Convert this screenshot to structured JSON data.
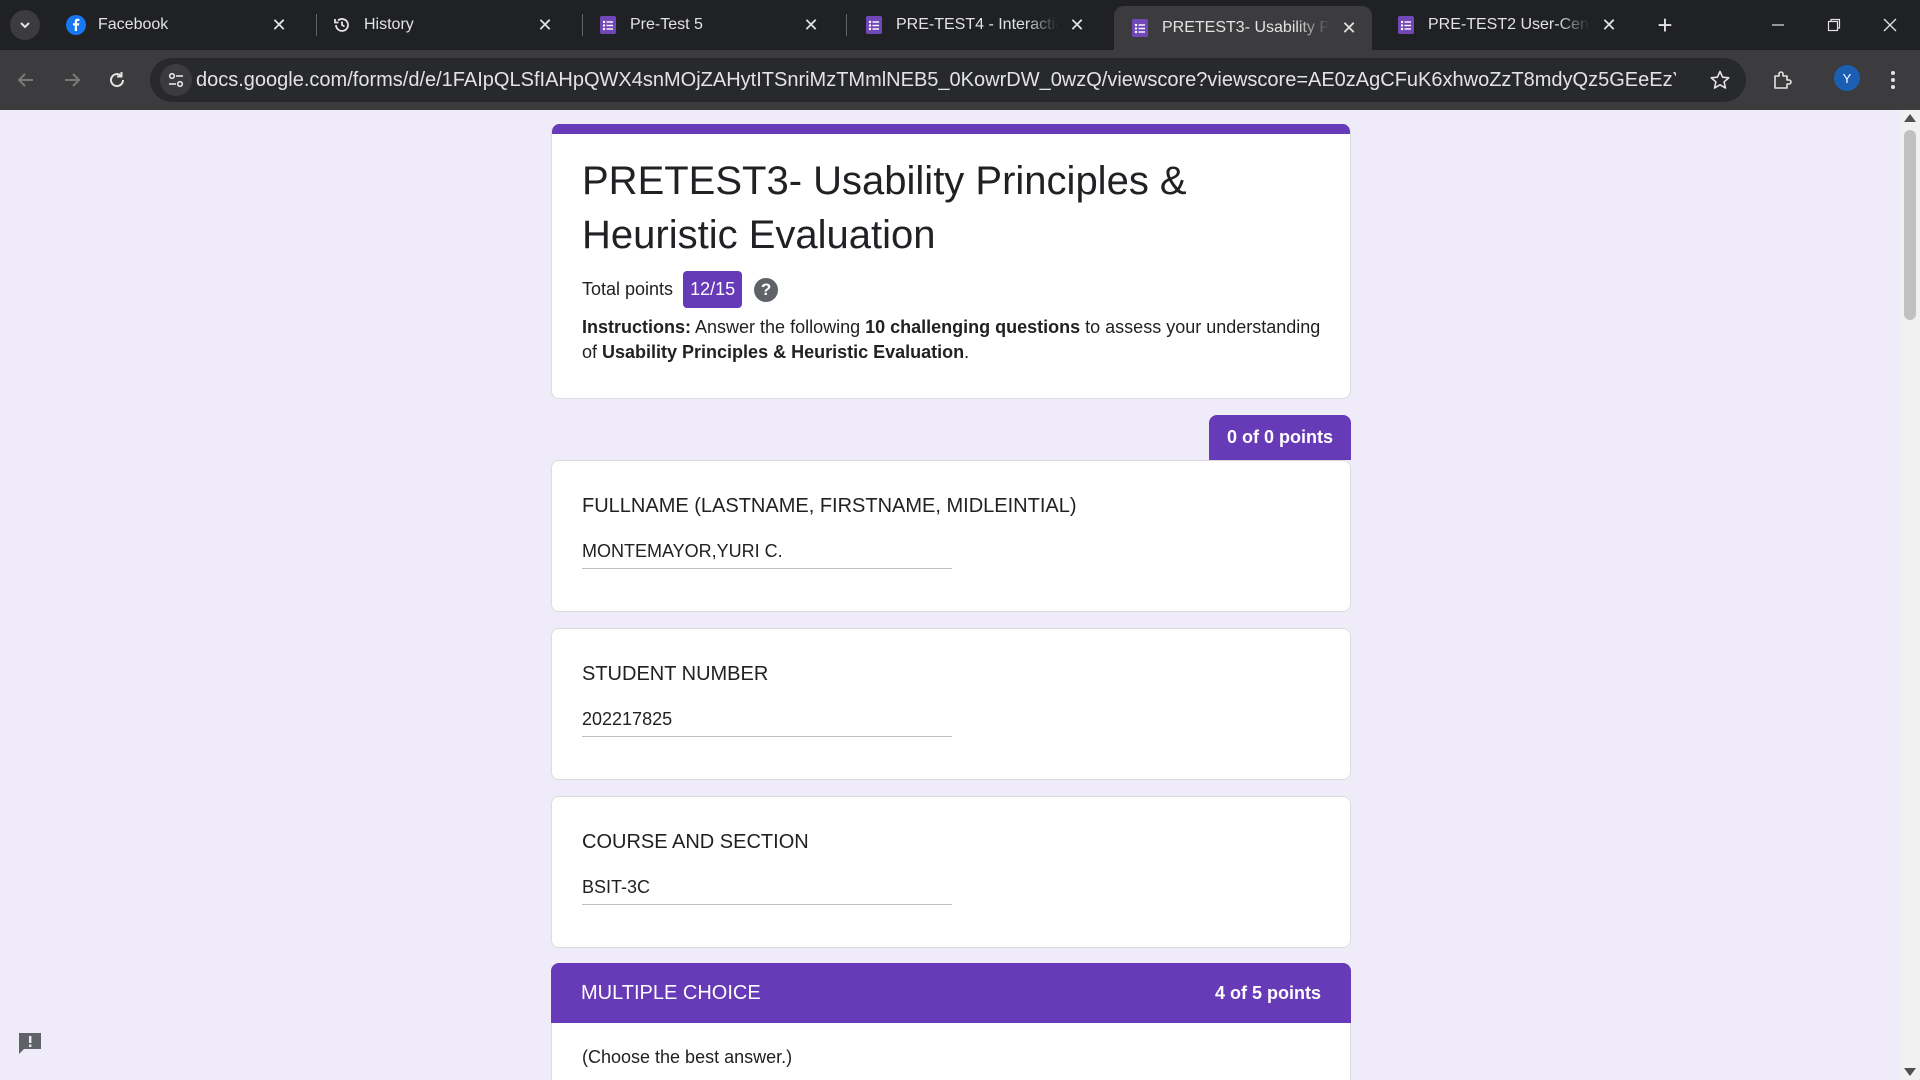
{
  "browser": {
    "tabs": [
      {
        "title": "Facebook",
        "icon": "facebook-icon",
        "active": false
      },
      {
        "title": "History",
        "icon": "history-icon",
        "active": false
      },
      {
        "title": "Pre-Test 5",
        "icon": "google-forms-icon",
        "active": false
      },
      {
        "title": "PRE-TEST4 - Interaction De",
        "icon": "google-forms-icon",
        "active": false
      },
      {
        "title": "PRETEST3- Usability Princip",
        "icon": "google-forms-icon",
        "active": true
      },
      {
        "title": "PRE-TEST2 User-Centered",
        "icon": "google-forms-icon",
        "active": false
      }
    ],
    "url": "docs.google.com/forms/d/e/1FAIpQLSfIAHpQWX4snMOjZAHytITSnriMzTMmlNEB5_0KowrDW_0wzQ/viewscore?viewscore=AE0zAgCFuK6xhwoZzT8mdyQz5GEeEzYG3OjpxUA54G-0Z7IdM3CTk_...",
    "profile_initial": "Y"
  },
  "form": {
    "title": "PRETEST3- Usability Principles & Heuristic Evaluation",
    "total_points_label": "Total points",
    "score": "12/15",
    "help_glyph": "?",
    "instructions": {
      "label": "Instructions:",
      "part1": " Answer the following ",
      "bold1": "10 challenging questions",
      "part2": " to assess your understanding of ",
      "bold2": "Usability Principles & Heuristic Evaluation",
      "part3": "."
    }
  },
  "section_points": "0 of 0 points",
  "questions": [
    {
      "title": "FULLNAME (LASTNAME, FIRSTNAME, MIDLEINTIAL)",
      "answer": "MONTEMAYOR,YURI C."
    },
    {
      "title": "STUDENT NUMBER",
      "answer": "202217825"
    },
    {
      "title": "COURSE AND SECTION",
      "answer": "BSIT-3C"
    }
  ],
  "multiple_choice": {
    "title": "MULTIPLE CHOICE",
    "points": "4 of 5 points",
    "description": "(Choose the best answer.)"
  },
  "colors": {
    "accent": "#673ab7",
    "page_background": "#f0ebf8",
    "chrome_dark": "#202124"
  }
}
